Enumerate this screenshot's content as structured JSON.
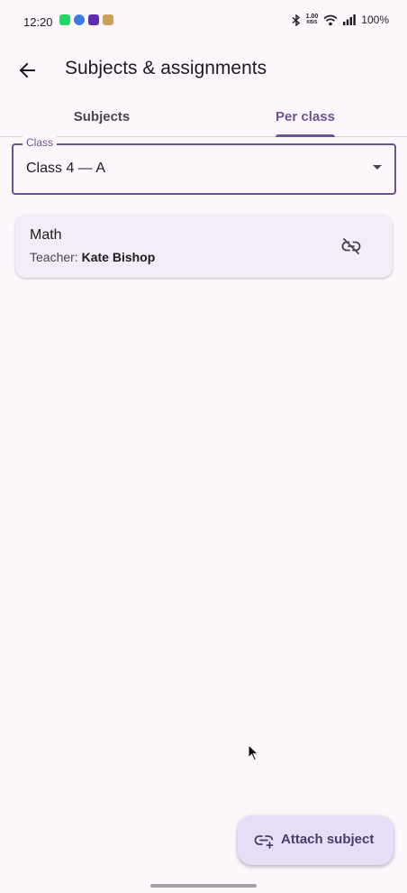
{
  "status_bar": {
    "time": "12:20",
    "speed_value": "1.00",
    "speed_unit": "KB/S",
    "battery": "100%",
    "left_icons": [
      "whatsapp-icon",
      "app-check-icon",
      "app-purple-icon",
      "app-box-icon"
    ]
  },
  "app_bar": {
    "title": "Subjects & assignments"
  },
  "tabs": [
    {
      "label": "Subjects",
      "active": false
    },
    {
      "label": "Per class",
      "active": true
    }
  ],
  "class_select": {
    "label": "Class",
    "value": "Class 4 — A"
  },
  "subjects": [
    {
      "name": "Math",
      "teacher_prefix": "Teacher:",
      "teacher_name": "Kate Bishop"
    }
  ],
  "fab": {
    "label": "Attach subject"
  },
  "colors": {
    "background": "#FDF7FC",
    "primary": "#6A5593",
    "card": "#F3EDF7",
    "fab": "#E8DDF6"
  }
}
